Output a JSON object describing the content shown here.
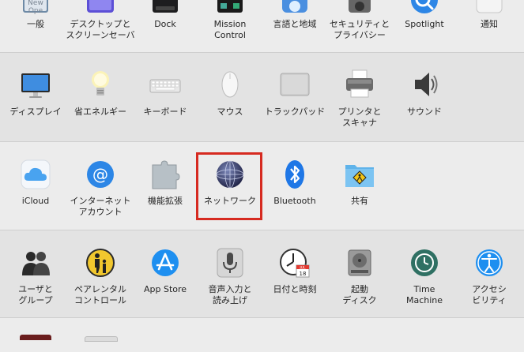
{
  "colors": {
    "highlight": "#d62a20",
    "band_light": "#ececec",
    "band_dark": "#e3e3e3"
  },
  "row1": [
    {
      "id": "general",
      "label": "一般",
      "icon": "general-icon"
    },
    {
      "id": "desktop",
      "label": "デスクトップと\nスクリーンセーバ",
      "icon": "desktop-screensaver-icon"
    },
    {
      "id": "dock",
      "label": "Dock",
      "icon": "dock-icon"
    },
    {
      "id": "mission",
      "label": "Mission\nControl",
      "icon": "mission-control-icon"
    },
    {
      "id": "language",
      "label": "言語と地域",
      "icon": "language-region-icon"
    },
    {
      "id": "security",
      "label": "セキュリティと\nプライバシー",
      "icon": "security-privacy-icon"
    },
    {
      "id": "spotlight",
      "label": "Spotlight",
      "icon": "spotlight-icon"
    },
    {
      "id": "notifications",
      "label": "通知",
      "icon": "notifications-icon"
    }
  ],
  "row2": [
    {
      "id": "displays",
      "label": "ディスプレイ",
      "icon": "display-icon"
    },
    {
      "id": "energy",
      "label": "省エネルギー",
      "icon": "energy-saver-icon"
    },
    {
      "id": "keyboard",
      "label": "キーボード",
      "icon": "keyboard-icon"
    },
    {
      "id": "mouse",
      "label": "マウス",
      "icon": "mouse-icon"
    },
    {
      "id": "trackpad",
      "label": "トラックパッド",
      "icon": "trackpad-icon"
    },
    {
      "id": "printers",
      "label": "プリンタと\nスキャナ",
      "icon": "printer-icon"
    },
    {
      "id": "sound",
      "label": "サウンド",
      "icon": "speaker-icon"
    }
  ],
  "row3": [
    {
      "id": "icloud",
      "label": "iCloud",
      "icon": "icloud-icon"
    },
    {
      "id": "internet",
      "label": "インターネット\nアカウント",
      "icon": "internet-accounts-icon"
    },
    {
      "id": "extensions",
      "label": "機能拡張",
      "icon": "extensions-icon"
    },
    {
      "id": "network",
      "label": "ネットワーク",
      "icon": "network-globe-icon"
    },
    {
      "id": "bluetooth",
      "label": "Bluetooth",
      "icon": "bluetooth-icon"
    },
    {
      "id": "sharing",
      "label": "共有",
      "icon": "sharing-folder-icon"
    }
  ],
  "row4": [
    {
      "id": "users",
      "label": "ユーザと\nグループ",
      "icon": "users-groups-icon"
    },
    {
      "id": "parental",
      "label": "ペアレンタル\nコントロール",
      "icon": "parental-controls-icon"
    },
    {
      "id": "appstore",
      "label": "App Store",
      "icon": "app-store-icon"
    },
    {
      "id": "dictation",
      "label": "音声入力と\n読み上げ",
      "icon": "microphone-icon"
    },
    {
      "id": "datetime",
      "label": "日付と時刻",
      "icon": "clock-calendar-icon"
    },
    {
      "id": "startup",
      "label": "起動\nディスク",
      "icon": "startup-disk-icon"
    },
    {
      "id": "timemachine",
      "label": "Time\nMachine",
      "icon": "time-machine-icon"
    },
    {
      "id": "accessibility",
      "label": "アクセシ\nビリティ",
      "icon": "accessibility-icon"
    }
  ],
  "general_icon_text": [
    "New",
    "Ope"
  ],
  "calendar_icon_text": {
    "month": "JUL",
    "day": "18"
  },
  "highlighted": "network"
}
